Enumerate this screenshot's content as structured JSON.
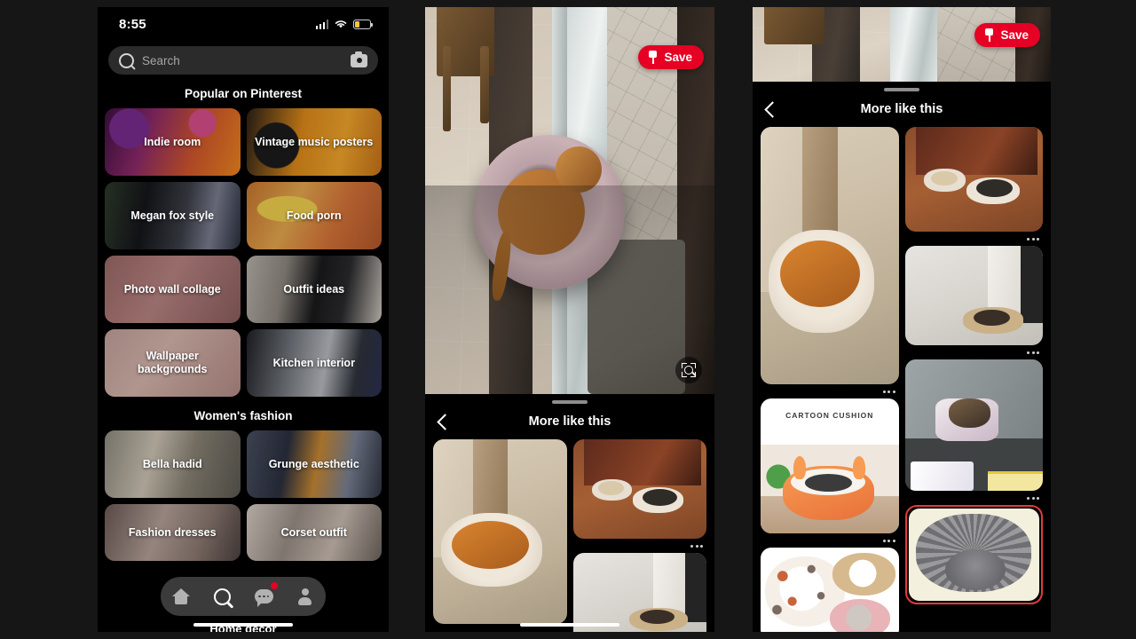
{
  "theme": {
    "background": "#161616",
    "panel_bg": "#000000",
    "accent_red": "#e60023",
    "selected_border": "#e03a3a"
  },
  "panel_search": {
    "status": {
      "time": "8:55",
      "signal_icon": "signal-bars-icon",
      "wifi_icon": "wifi-icon",
      "battery_icon": "battery-low-icon"
    },
    "search": {
      "placeholder": "Search",
      "search_icon": "search-icon",
      "camera_icon": "camera-icon"
    },
    "sections": [
      {
        "title": "Popular on Pinterest",
        "tiles": [
          {
            "label": "Indie room",
            "art": "bg-indie"
          },
          {
            "label": "Vintage music posters",
            "art": "bg-vintage"
          },
          {
            "label": "Megan fox style",
            "art": "bg-megan"
          },
          {
            "label": "Food porn",
            "art": "bg-food"
          },
          {
            "label": "Photo wall collage",
            "art": "bg-photo"
          },
          {
            "label": "Outfit ideas",
            "art": "bg-outfit"
          },
          {
            "label": "Wallpaper backgrounds",
            "art": "bg-wall"
          },
          {
            "label": "Kitchen interior",
            "art": "bg-kitchen"
          }
        ]
      },
      {
        "title": "Women's fashion",
        "tiles": [
          {
            "label": "Bella hadid",
            "art": "bg-bella"
          },
          {
            "label": "Grunge aesthetic",
            "art": "bg-grunge"
          },
          {
            "label": "Fashion dresses",
            "art": "bg-dresses"
          },
          {
            "label": "Corset outfit",
            "art": "bg-corset"
          }
        ]
      }
    ],
    "next_section_peek": "Home decor",
    "bottom_nav": [
      {
        "name": "home",
        "icon": "home-icon",
        "active": false
      },
      {
        "name": "search",
        "icon": "search-icon",
        "active": true
      },
      {
        "name": "messages",
        "icon": "chat-bubble-icon",
        "active": false,
        "badge": true
      },
      {
        "name": "profile",
        "icon": "person-icon",
        "active": false
      }
    ]
  },
  "panel_pin": {
    "save_label": "Save",
    "save_icon": "pushpin-icon",
    "lens_icon": "visual-search-icon",
    "sheet_title": "More like this",
    "back_icon": "back-chevron-icon",
    "overflow_icon": "ellipsis-icon",
    "hero_alt": "dachshund lying in a pink fluffy donut dog bed by a sliding glass door",
    "related_pins": [
      {
        "name": "orange-cat-in-bed",
        "art": "a-cat"
      },
      {
        "name": "two-dogs-in-beds",
        "art": "a-dogs2"
      },
      {
        "name": "puppy-in-hallway-bed",
        "art": "a-hall"
      },
      {
        "name": "terrier-in-purple-bed",
        "art": "a-terr"
      },
      {
        "name": "cartoon-cushion-product",
        "art": "a-cart",
        "caption": "CARTOON CUSHION"
      },
      {
        "name": "paw-print-bed-collage",
        "art": "a-paw"
      },
      {
        "name": "grey-fluffy-bed",
        "art": "a-grey",
        "selected": true
      }
    ]
  }
}
